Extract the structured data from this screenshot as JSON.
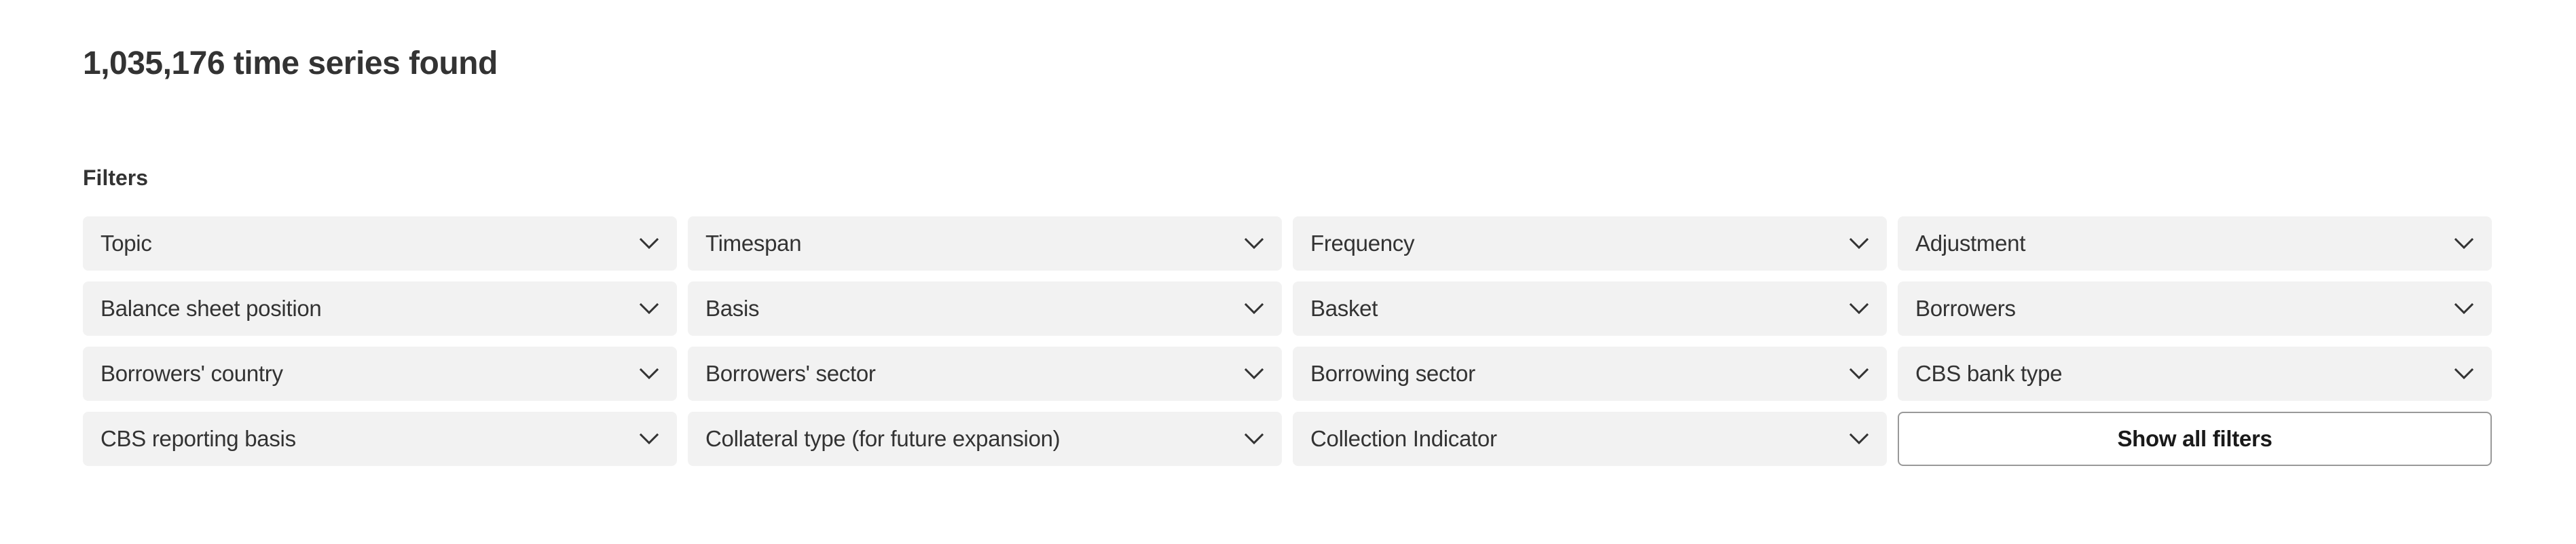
{
  "results": {
    "title": "1,035,176 time series found"
  },
  "filters": {
    "heading": "Filters",
    "dropdowns": [
      {
        "label": "Topic"
      },
      {
        "label": "Timespan"
      },
      {
        "label": "Frequency"
      },
      {
        "label": "Adjustment"
      },
      {
        "label": "Balance sheet position"
      },
      {
        "label": "Basis"
      },
      {
        "label": "Basket"
      },
      {
        "label": "Borrowers"
      },
      {
        "label": "Borrowers' country"
      },
      {
        "label": "Borrowers' sector"
      },
      {
        "label": "Borrowing sector"
      },
      {
        "label": "CBS bank type"
      },
      {
        "label": "CBS reporting basis"
      },
      {
        "label": "Collateral type (for future expansion)"
      },
      {
        "label": "Collection Indicator"
      }
    ],
    "dropdown_icon": "chevron-down-icon",
    "show_all_label": "Show all filters"
  },
  "colors": {
    "text": "#333333",
    "dropdown_bg": "#f2f2f2",
    "button_border": "#999999",
    "button_text": "#1a1a1a",
    "background": "#ffffff"
  }
}
